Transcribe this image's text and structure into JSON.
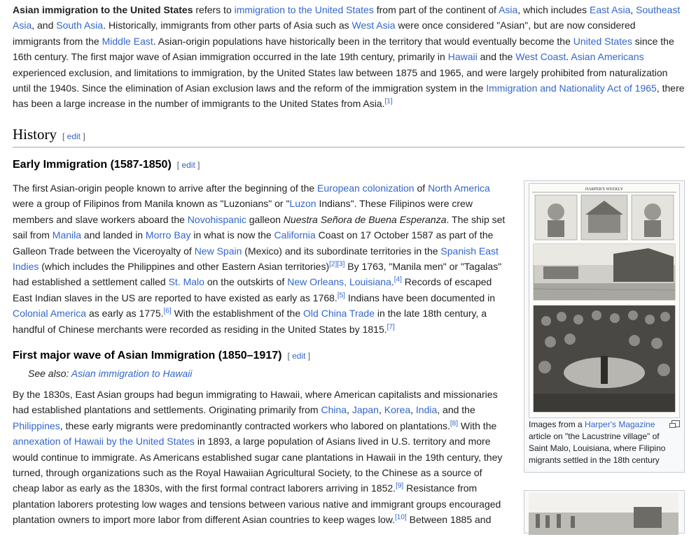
{
  "lead": {
    "b1": "Asian immigration to the United States",
    "t1": " refers to ",
    "a1": "immigration to the United States",
    "t2": " from part of the continent of ",
    "a2": "Asia",
    "t3": ", which includes ",
    "a3": "East Asia",
    "t4": ", ",
    "a4": "Southeast Asia",
    "t5": ", and ",
    "a5": "South Asia",
    "t6": ". Historically, immigrants from other parts of Asia such as ",
    "a6": "West Asia",
    "t7": " were once considered \"Asian\", but are now considered immigrants from the ",
    "a7": "Middle East",
    "t8": ". Asian-origin populations have historically been in the territory that would eventually become the ",
    "a8": "United States",
    "t9": " since the 16th century. The first major wave of Asian immigration occurred in the late 19th century, primarily in ",
    "a9": "Hawaii",
    "t10": " and the ",
    "a10": "West Coast",
    "t11": ". ",
    "a11": "Asian Americans",
    "t12": " experienced exclusion, and limitations to immigration, by the United States law between 1875 and 1965, and were largely prohibited from naturalization until the 1940s. Since the elimination of Asian exclusion laws and the reform of the immigration system in the ",
    "a12": "Immigration and Nationality Act of 1965",
    "t13": ", there has been a large increase in the number of immigrants to the United States from Asia.",
    "s1": "[1]"
  },
  "history": {
    "title": "History",
    "edit": "edit"
  },
  "early": {
    "title": "Early Immigration (1587-1850)",
    "edit": "edit",
    "t1": "The first Asian-origin people known to arrive after the beginning of the ",
    "a1": "European colonization",
    "t2": " of ",
    "a2": "North America",
    "t3": " were a group of Filipinos from Manila known as \"Luzonians\" or \"",
    "a3": "Luzon",
    "t4": " Indians\". These Filipinos were crew members and slave workers aboard the ",
    "a4": "Novohispanic",
    "t5": " galleon ",
    "i1": "Nuestra Señora de Buena Esperanza",
    "t6": ". The ship set sail from ",
    "a5": "Manila",
    "t7": " and landed in ",
    "a6": "Morro Bay",
    "t8": " in what is now the ",
    "a7": "California",
    "t9": " Coast on 17 October 1587 as part of the Galleon Trade between the Viceroyalty of ",
    "a8": "New Spain",
    "t10": " (Mexico) and its subordinate territories in the ",
    "a9": "Spanish East Indies",
    "t11": " (which includes the Philippines and other Eastern Asian territories)",
    "s1": "[2]",
    "s2": "[3]",
    "t12": " By 1763, \"Manila men\" or \"Tagalas\" had established a settlement called ",
    "a10": "St. Malo",
    "t13": " on the outskirts of ",
    "a11": "New Orleans, Louisiana",
    "t14": ".",
    "s3": "[4]",
    "t15": " Records of escaped East Indian slaves in the US are reported to have existed as early as 1768.",
    "s4": "[5]",
    "t16": " Indians have been documented in ",
    "a12": "Colonial America",
    "t17": " as early as 1775.",
    "s5": "[6]",
    "t18": " With the establishment of the ",
    "a13": "Old China Trade",
    "t19": " in the late 18th century, a handful of Chinese merchants were recorded as residing in the United States by 1815.",
    "s6": "[7]"
  },
  "wave": {
    "title": "First major wave of Asian Immigration (1850–1917)",
    "edit": "edit",
    "seealso_label": "See also: ",
    "seealso_link": "Asian immigration to Hawaii",
    "t1": "By the 1830s, East Asian groups had begun immigrating to Hawaii, where American capitalists and missionaries had established plantations and settlements. Originating primarily from ",
    "a1": "China",
    "c1": ", ",
    "a2": "Japan",
    "c2": ", ",
    "a3": "Korea",
    "c3": ", ",
    "a4": "India",
    "t2": ", and the ",
    "a5": "Philippines",
    "t3": ", these early migrants were predominantly contracted workers who labored on plantations.",
    "s1": "[8]",
    "t4": " With the ",
    "a6": "annexation of Hawaii by the United States",
    "t5": " in 1893, a large population of Asians lived in U.S. territory and more would continue to immigrate. As Americans established sugar cane plantations in Hawaii in the 19th century, they turned, through organizations such as the Royal Hawaiian Agricultural Society, to the Chinese as a source of cheap labor as early as the 1830s, with the first formal contract laborers arriving in 1852.",
    "s2": "[9]",
    "t6": " Resistance from plantation laborers protesting low wages and tensions between various native and immigrant groups encouraged plantation owners to import more labor from different Asian countries to keep wages low.",
    "s3": "[10]",
    "t7": " Between 1885 and"
  },
  "figure": {
    "masthead": "HARPER'S WEEKLY",
    "caption_t1": "Images from a ",
    "caption_a1": "Harper's Magazine",
    "caption_t2": " article on \"the Lacustrine village\" of Saint Malo, Louisiana, where Filipino migrants settled in the 18th century"
  },
  "colors": {
    "link": "#3366cc",
    "text": "#202122",
    "border": "#a2a9b1"
  }
}
